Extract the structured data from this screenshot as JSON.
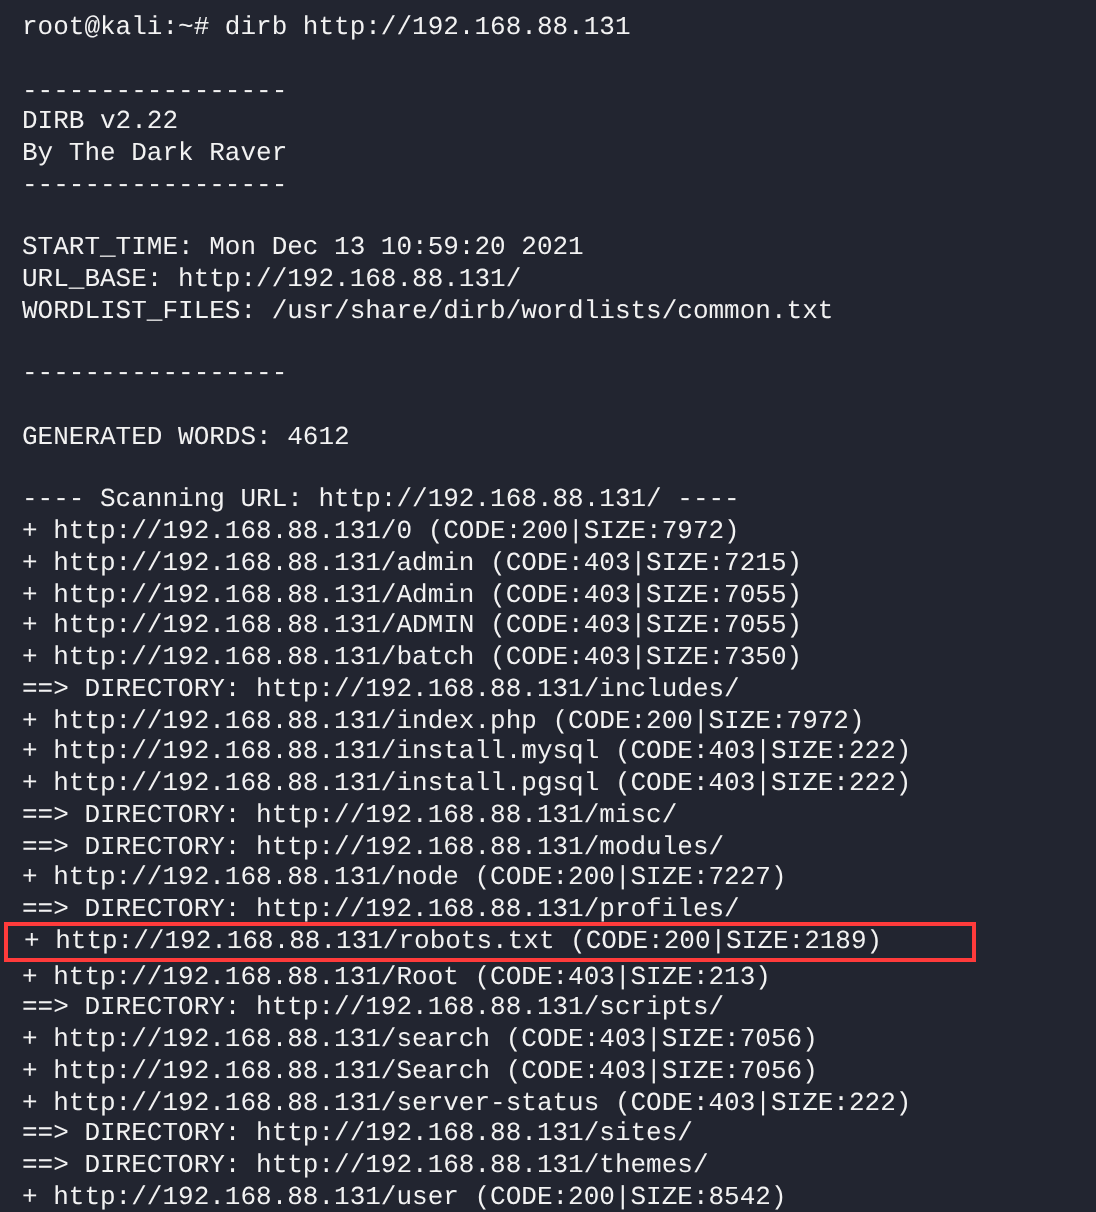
{
  "terminal": {
    "lines": [
      {
        "kind": "text",
        "text": "root@kali:~# dirb http://192.168.88.131",
        "highlighted": false
      },
      {
        "kind": "blank"
      },
      {
        "kind": "text",
        "text": "-----------------",
        "highlighted": false
      },
      {
        "kind": "text",
        "text": "DIRB v2.22",
        "highlighted": false
      },
      {
        "kind": "text",
        "text": "By The Dark Raver",
        "highlighted": false
      },
      {
        "kind": "text",
        "text": "-----------------",
        "highlighted": false
      },
      {
        "kind": "blank"
      },
      {
        "kind": "text",
        "text": "START_TIME: Mon Dec 13 10:59:20 2021",
        "highlighted": false
      },
      {
        "kind": "text",
        "text": "URL_BASE: http://192.168.88.131/",
        "highlighted": false
      },
      {
        "kind": "text",
        "text": "WORDLIST_FILES: /usr/share/dirb/wordlists/common.txt",
        "highlighted": false
      },
      {
        "kind": "blank"
      },
      {
        "kind": "text",
        "text": "-----------------",
        "highlighted": false
      },
      {
        "kind": "blank"
      },
      {
        "kind": "text",
        "text": "GENERATED WORDS: 4612",
        "highlighted": false
      },
      {
        "kind": "blank"
      },
      {
        "kind": "text",
        "text": "---- Scanning URL: http://192.168.88.131/ ----",
        "highlighted": false
      },
      {
        "kind": "text",
        "text": "+ http://192.168.88.131/0 (CODE:200|SIZE:7972)",
        "highlighted": false
      },
      {
        "kind": "text",
        "text": "+ http://192.168.88.131/admin (CODE:403|SIZE:7215)",
        "highlighted": false
      },
      {
        "kind": "text",
        "text": "+ http://192.168.88.131/Admin (CODE:403|SIZE:7055)",
        "highlighted": false
      },
      {
        "kind": "text",
        "text": "+ http://192.168.88.131/ADMIN (CODE:403|SIZE:7055)",
        "highlighted": false
      },
      {
        "kind": "text",
        "text": "+ http://192.168.88.131/batch (CODE:403|SIZE:7350)",
        "highlighted": false
      },
      {
        "kind": "text",
        "text": "==> DIRECTORY: http://192.168.88.131/includes/",
        "highlighted": false
      },
      {
        "kind": "text",
        "text": "+ http://192.168.88.131/index.php (CODE:200|SIZE:7972)",
        "highlighted": false
      },
      {
        "kind": "text",
        "text": "+ http://192.168.88.131/install.mysql (CODE:403|SIZE:222)",
        "highlighted": false
      },
      {
        "kind": "text",
        "text": "+ http://192.168.88.131/install.pgsql (CODE:403|SIZE:222)",
        "highlighted": false
      },
      {
        "kind": "text",
        "text": "==> DIRECTORY: http://192.168.88.131/misc/",
        "highlighted": false
      },
      {
        "kind": "text",
        "text": "==> DIRECTORY: http://192.168.88.131/modules/",
        "highlighted": false
      },
      {
        "kind": "text",
        "text": "+ http://192.168.88.131/node (CODE:200|SIZE:7227)",
        "highlighted": false
      },
      {
        "kind": "text",
        "text": "==> DIRECTORY: http://192.168.88.131/profiles/",
        "highlighted": false
      },
      {
        "kind": "text",
        "text": "+ http://192.168.88.131/robots.txt (CODE:200|SIZE:2189)",
        "highlighted": true
      },
      {
        "kind": "text",
        "text": "+ http://192.168.88.131/Root (CODE:403|SIZE:213)",
        "highlighted": false
      },
      {
        "kind": "text",
        "text": "==> DIRECTORY: http://192.168.88.131/scripts/",
        "highlighted": false
      },
      {
        "kind": "text",
        "text": "+ http://192.168.88.131/search (CODE:403|SIZE:7056)",
        "highlighted": false
      },
      {
        "kind": "text",
        "text": "+ http://192.168.88.131/Search (CODE:403|SIZE:7056)",
        "highlighted": false
      },
      {
        "kind": "text",
        "text": "+ http://192.168.88.131/server-status (CODE:403|SIZE:222)",
        "highlighted": false
      },
      {
        "kind": "text",
        "text": "==> DIRECTORY: http://192.168.88.131/sites/",
        "highlighted": false
      },
      {
        "kind": "text",
        "text": "==> DIRECTORY: http://192.168.88.131/themes/",
        "highlighted": false
      },
      {
        "kind": "text",
        "text": "+ http://192.168.88.131/user (CODE:200|SIZE:8542)",
        "highlighted": false
      }
    ]
  }
}
